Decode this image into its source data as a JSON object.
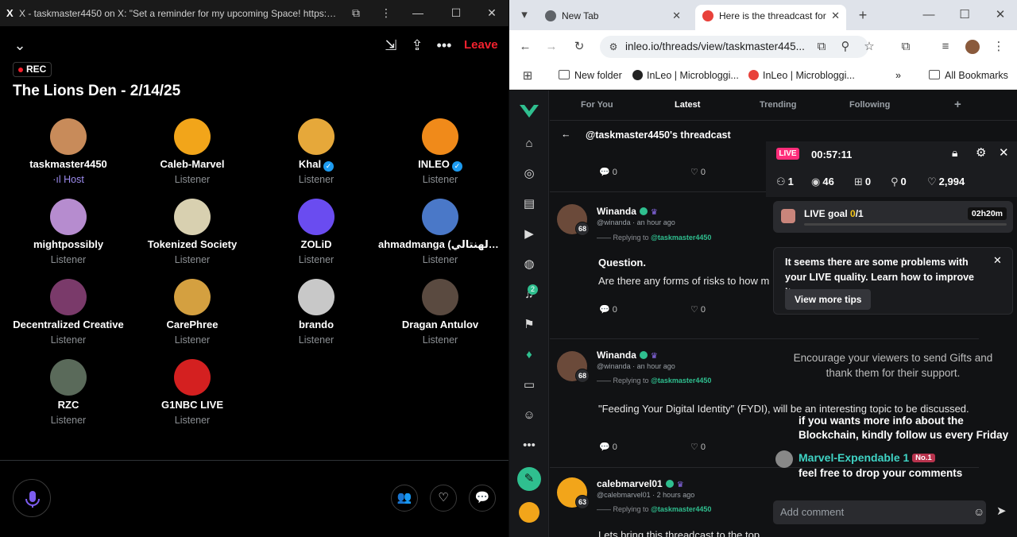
{
  "left": {
    "window_title": "X - taskmaster4450 on X: \"Set a reminder for my upcoming Space! https://t.co...",
    "leave_label": "Leave",
    "rec_label": "REC",
    "space_title": "The Lions Den - 2/14/25",
    "participants": [
      {
        "name": "taskmaster4450",
        "role": "Host",
        "verified": false
      },
      {
        "name": "Caleb-Marvel",
        "role": "Listener",
        "verified": false
      },
      {
        "name": "Khal",
        "role": "Listener",
        "verified": true
      },
      {
        "name": "INLEO",
        "role": "Listener",
        "verified": true
      },
      {
        "name": "mightpossibly",
        "role": "Listener",
        "verified": false
      },
      {
        "name": "Tokenized Society",
        "role": "Listener",
        "verified": false
      },
      {
        "name": "ZOLiD",
        "role": "Listener",
        "verified": false
      },
      {
        "name": "ahmadmanga (أحمد الهنتالي)",
        "role": "Listener",
        "verified": false
      },
      {
        "name": "Decentralized Creative",
        "role": "Listener",
        "verified": false
      },
      {
        "name": "CarePhree",
        "role": "Listener",
        "verified": false
      },
      {
        "name": "brando",
        "role": "Listener",
        "verified": false
      },
      {
        "name": "Dragan Antulov",
        "role": "Listener",
        "verified": false
      },
      {
        "name": "RZC",
        "role": "Listener",
        "verified": false
      },
      {
        "name": "G1NBC LIVE",
        "role": "Listener",
        "verified": false
      }
    ]
  },
  "browser": {
    "tabs": [
      {
        "label": "New Tab",
        "active": false
      },
      {
        "label": "Here is the threadcast for",
        "active": true
      }
    ],
    "url": "inleo.io/threads/view/taskmaster445...",
    "bookmarks": [
      "New folder",
      "InLeo | Microbloggi...",
      "InLeo | Microbloggi...",
      "All Bookmarks"
    ]
  },
  "inleo": {
    "nav_tabs": [
      "For You",
      "Latest",
      "Trending",
      "Following"
    ],
    "active_tab": "Latest",
    "notification_count": "2",
    "thread_title": "@taskmaster4450's threadcast",
    "replying_label": "Replying to",
    "posts": [
      {
        "name": "Winanda",
        "handle": "@winanda",
        "time": "an hour ago",
        "level": "68",
        "replying_to": "@taskmaster4450",
        "body_title": "Question.",
        "body": "Are there any forms of risks to how m",
        "comments": "0",
        "likes": "0"
      },
      {
        "name": "Winanda",
        "handle": "@winanda",
        "time": "an hour ago",
        "level": "68",
        "replying_to": "@taskmaster4450",
        "body": "\"Feeding Your Digital Identity\" (FYDI), will be an interesting topic to be discussed.",
        "comments": "0",
        "likes": "0"
      },
      {
        "name": "calebmarvel01",
        "handle": "@calebmarvel01",
        "time": "2 hours ago",
        "level": "63",
        "replying_to": "@taskmaster4450",
        "body": "Lets bring this threadcast to the top"
      }
    ],
    "top_post_stats": {
      "comments": "0",
      "likes": "0"
    }
  },
  "live": {
    "badge": "LIVE",
    "timer": "00:57:11",
    "stats": {
      "members": "1",
      "views": "46",
      "gifts": "0",
      "joins": "0",
      "likes": "2,994"
    },
    "goal_label": "LIVE goal",
    "goal_progress": "0",
    "goal_total": "/1",
    "goal_fraction": 0,
    "goal_time": "02h20m",
    "tip_text": "It seems there are some problems with your LIVE quality. Learn how to improve it.",
    "tip_button": "View more tips",
    "encourage": "Encourage your viewers to send Gifts and thank them for their support.",
    "chat": [
      {
        "text": "if you wants more info about the"
      },
      {
        "text": "Blockchain, kindly follow us every Friday"
      }
    ],
    "chat_user": "Marvel-Expendable 1",
    "chat_user_rank": "No.1",
    "chat_last": "feel free to drop your comments",
    "comment_placeholder": "Add comment",
    "colors": {
      "live_pink": "#ff2d7a",
      "chat_user": "#3fd3c4",
      "inleo_green": "#2fbf8f"
    }
  }
}
